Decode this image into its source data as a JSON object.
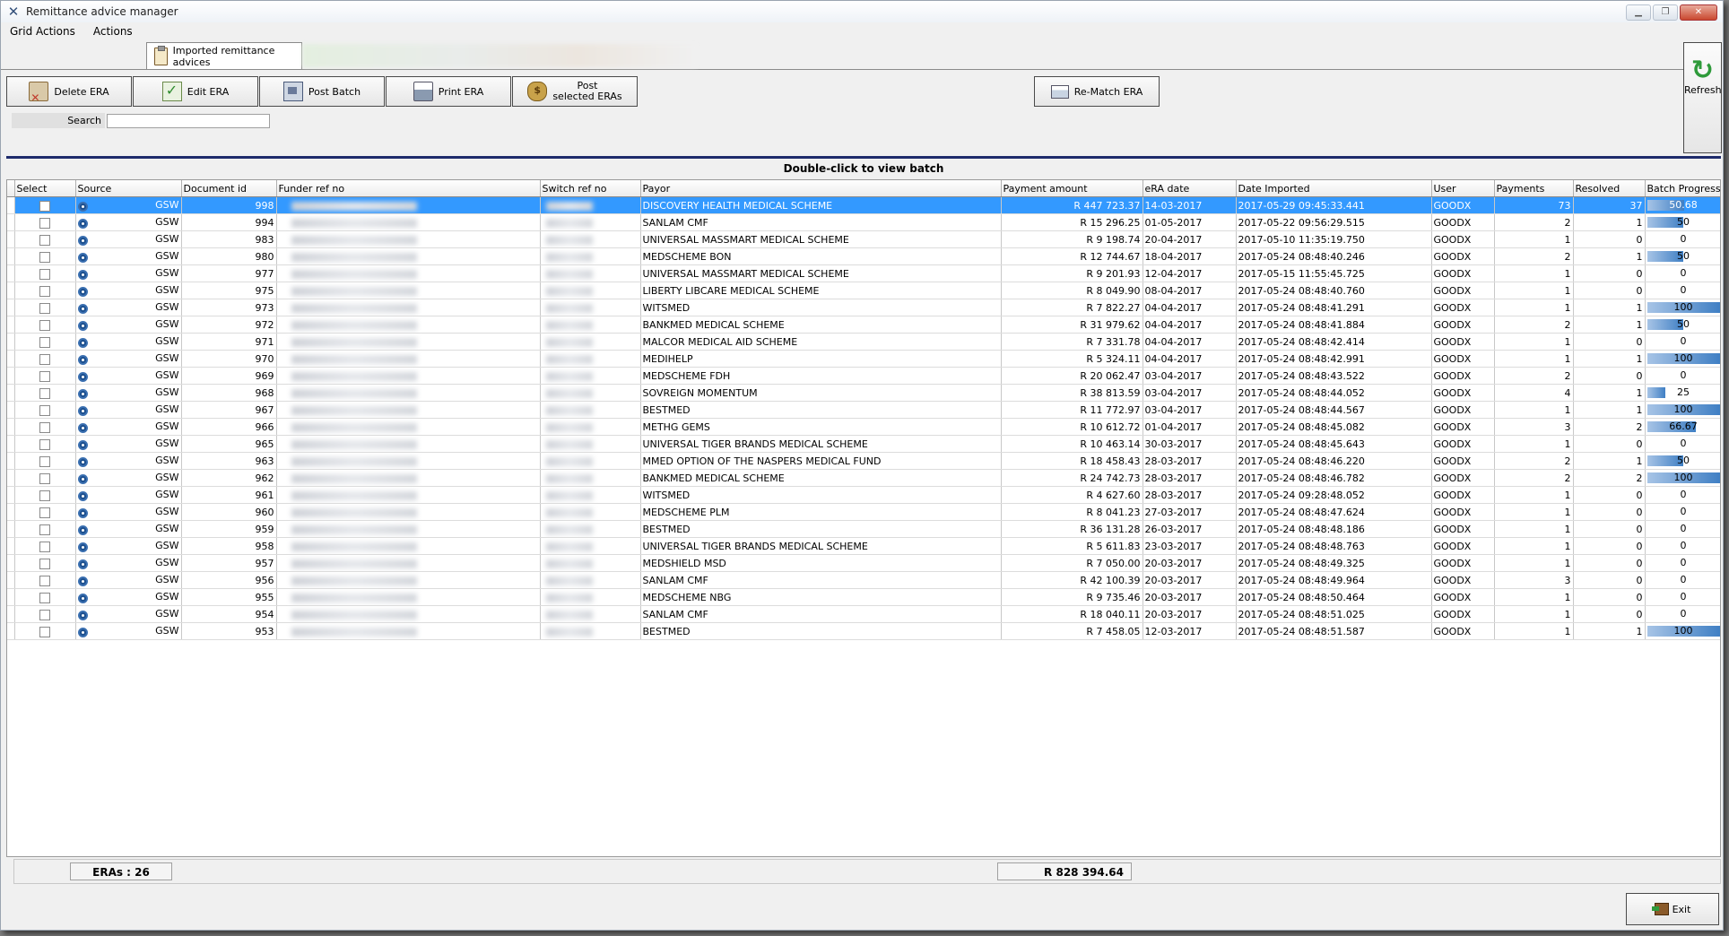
{
  "window": {
    "title": "Remittance advice manager"
  },
  "menu": [
    "Grid Actions",
    "Actions"
  ],
  "tabs": {
    "active_label": "Imported remittance advices"
  },
  "toolbar": {
    "delete": "Delete ERA",
    "edit": "Edit ERA",
    "post_batch": "Post Batch",
    "print": "Print ERA",
    "post_selected_line1": "Post",
    "post_selected_line2": "selected ERAs",
    "rematch": "Re-Match ERA",
    "refresh": "Refresh"
  },
  "search": {
    "label": "Search",
    "value": ""
  },
  "grid": {
    "caption": "Double-click to view batch",
    "columns": [
      "Select",
      "Source",
      "Document id",
      "Funder ref no",
      "Switch ref no",
      "Payor",
      "Payment amount",
      "eRA date",
      "Date Imported",
      "User",
      "Payments",
      "Resolved",
      "Batch Progress (%)"
    ],
    "rows": [
      {
        "source": "GSW",
        "doc": "998",
        "payor": "DISCOVERY HEALTH MEDICAL SCHEME",
        "amount": "R 447 723.37",
        "era_date": "14-03-2017",
        "imported": "2017-05-29 09:45:33.441",
        "user": "GOODX",
        "payments": "73",
        "resolved": "37",
        "progress": "50.68"
      },
      {
        "source": "GSW",
        "doc": "994",
        "payor": "SANLAM CMF",
        "amount": "R 15 296.25",
        "era_date": "01-05-2017",
        "imported": "2017-05-22 09:56:29.515",
        "user": "GOODX",
        "payments": "2",
        "resolved": "1",
        "progress": "50"
      },
      {
        "source": "GSW",
        "doc": "983",
        "payor": "UNIVERSAL MASSMART MEDICAL SCHEME",
        "amount": "R 9 198.74",
        "era_date": "20-04-2017",
        "imported": "2017-05-10 11:35:19.750",
        "user": "GOODX",
        "payments": "1",
        "resolved": "0",
        "progress": "0"
      },
      {
        "source": "GSW",
        "doc": "980",
        "payor": "MEDSCHEME BON",
        "amount": "R 12 744.67",
        "era_date": "18-04-2017",
        "imported": "2017-05-24 08:48:40.246",
        "user": "GOODX",
        "payments": "2",
        "resolved": "1",
        "progress": "50"
      },
      {
        "source": "GSW",
        "doc": "977",
        "payor": "UNIVERSAL MASSMART MEDICAL SCHEME",
        "amount": "R 9 201.93",
        "era_date": "12-04-2017",
        "imported": "2017-05-15 11:55:45.725",
        "user": "GOODX",
        "payments": "1",
        "resolved": "0",
        "progress": "0"
      },
      {
        "source": "GSW",
        "doc": "975",
        "payor": "LIBERTY LIBCARE MEDICAL SCHEME",
        "amount": "R 8 049.90",
        "era_date": "08-04-2017",
        "imported": "2017-05-24 08:48:40.760",
        "user": "GOODX",
        "payments": "1",
        "resolved": "0",
        "progress": "0"
      },
      {
        "source": "GSW",
        "doc": "973",
        "payor": "WITSMED",
        "amount": "R 7 822.27",
        "era_date": "04-04-2017",
        "imported": "2017-05-24 08:48:41.291",
        "user": "GOODX",
        "payments": "1",
        "resolved": "1",
        "progress": "100"
      },
      {
        "source": "GSW",
        "doc": "972",
        "payor": "BANKMED MEDICAL SCHEME",
        "amount": "R 31 979.62",
        "era_date": "04-04-2017",
        "imported": "2017-05-24 08:48:41.884",
        "user": "GOODX",
        "payments": "2",
        "resolved": "1",
        "progress": "50"
      },
      {
        "source": "GSW",
        "doc": "971",
        "payor": "MALCOR MEDICAL AID SCHEME",
        "amount": "R 7 331.78",
        "era_date": "04-04-2017",
        "imported": "2017-05-24 08:48:42.414",
        "user": "GOODX",
        "payments": "1",
        "resolved": "0",
        "progress": "0"
      },
      {
        "source": "GSW",
        "doc": "970",
        "payor": "MEDIHELP",
        "amount": "R 5 324.11",
        "era_date": "04-04-2017",
        "imported": "2017-05-24 08:48:42.991",
        "user": "GOODX",
        "payments": "1",
        "resolved": "1",
        "progress": "100"
      },
      {
        "source": "GSW",
        "doc": "969",
        "payor": "MEDSCHEME FDH",
        "amount": "R 20 062.47",
        "era_date": "03-04-2017",
        "imported": "2017-05-24 08:48:43.522",
        "user": "GOODX",
        "payments": "2",
        "resolved": "0",
        "progress": "0"
      },
      {
        "source": "GSW",
        "doc": "968",
        "payor": "SOVREIGN MOMENTUM",
        "amount": "R 38 813.59",
        "era_date": "03-04-2017",
        "imported": "2017-05-24 08:48:44.052",
        "user": "GOODX",
        "payments": "4",
        "resolved": "1",
        "progress": "25"
      },
      {
        "source": "GSW",
        "doc": "967",
        "payor": "BESTMED",
        "amount": "R 11 772.97",
        "era_date": "03-04-2017",
        "imported": "2017-05-24 08:48:44.567",
        "user": "GOODX",
        "payments": "1",
        "resolved": "1",
        "progress": "100"
      },
      {
        "source": "GSW",
        "doc": "966",
        "payor": "METHG GEMS",
        "amount": "R 10 612.72",
        "era_date": "01-04-2017",
        "imported": "2017-05-24 08:48:45.082",
        "user": "GOODX",
        "payments": "3",
        "resolved": "2",
        "progress": "66.67"
      },
      {
        "source": "GSW",
        "doc": "965",
        "payor": "UNIVERSAL TIGER BRANDS MEDICAL SCHEME",
        "amount": "R 10 463.14",
        "era_date": "30-03-2017",
        "imported": "2017-05-24 08:48:45.643",
        "user": "GOODX",
        "payments": "1",
        "resolved": "0",
        "progress": "0"
      },
      {
        "source": "GSW",
        "doc": "963",
        "payor": "MMED OPTION OF THE NASPERS MEDICAL FUND",
        "amount": "R 18 458.43",
        "era_date": "28-03-2017",
        "imported": "2017-05-24 08:48:46.220",
        "user": "GOODX",
        "payments": "2",
        "resolved": "1",
        "progress": "50"
      },
      {
        "source": "GSW",
        "doc": "962",
        "payor": "BANKMED MEDICAL SCHEME",
        "amount": "R 24 742.73",
        "era_date": "28-03-2017",
        "imported": "2017-05-24 08:48:46.782",
        "user": "GOODX",
        "payments": "2",
        "resolved": "2",
        "progress": "100"
      },
      {
        "source": "GSW",
        "doc": "961",
        "payor": "WITSMED",
        "amount": "R 4 627.60",
        "era_date": "28-03-2017",
        "imported": "2017-05-24 09:28:48.052",
        "user": "GOODX",
        "payments": "1",
        "resolved": "0",
        "progress": "0"
      },
      {
        "source": "GSW",
        "doc": "960",
        "payor": "MEDSCHEME PLM",
        "amount": "R 8 041.23",
        "era_date": "27-03-2017",
        "imported": "2017-05-24 08:48:47.624",
        "user": "GOODX",
        "payments": "1",
        "resolved": "0",
        "progress": "0"
      },
      {
        "source": "GSW",
        "doc": "959",
        "payor": "BESTMED",
        "amount": "R 36 131.28",
        "era_date": "26-03-2017",
        "imported": "2017-05-24 08:48:48.186",
        "user": "GOODX",
        "payments": "1",
        "resolved": "0",
        "progress": "0"
      },
      {
        "source": "GSW",
        "doc": "958",
        "payor": "UNIVERSAL TIGER BRANDS MEDICAL SCHEME",
        "amount": "R 5 611.83",
        "era_date": "23-03-2017",
        "imported": "2017-05-24 08:48:48.763",
        "user": "GOODX",
        "payments": "1",
        "resolved": "0",
        "progress": "0"
      },
      {
        "source": "GSW",
        "doc": "957",
        "payor": "MEDSHIELD MSD",
        "amount": "R 7 050.00",
        "era_date": "20-03-2017",
        "imported": "2017-05-24 08:48:49.325",
        "user": "GOODX",
        "payments": "1",
        "resolved": "0",
        "progress": "0"
      },
      {
        "source": "GSW",
        "doc": "956",
        "payor": "SANLAM CMF",
        "amount": "R 42 100.39",
        "era_date": "20-03-2017",
        "imported": "2017-05-24 08:48:49.964",
        "user": "GOODX",
        "payments": "3",
        "resolved": "0",
        "progress": "0"
      },
      {
        "source": "GSW",
        "doc": "955",
        "payor": "MEDSCHEME NBG",
        "amount": "R 9 735.46",
        "era_date": "20-03-2017",
        "imported": "2017-05-24 08:48:50.464",
        "user": "GOODX",
        "payments": "1",
        "resolved": "0",
        "progress": "0"
      },
      {
        "source": "GSW",
        "doc": "954",
        "payor": "SANLAM CMF",
        "amount": "R 18 040.11",
        "era_date": "20-03-2017",
        "imported": "2017-05-24 08:48:51.025",
        "user": "GOODX",
        "payments": "1",
        "resolved": "0",
        "progress": "0"
      },
      {
        "source": "GSW",
        "doc": "953",
        "payor": "BESTMED",
        "amount": "R 7 458.05",
        "era_date": "12-03-2017",
        "imported": "2017-05-24 08:48:51.587",
        "user": "GOODX",
        "payments": "1",
        "resolved": "1",
        "progress": "100"
      }
    ]
  },
  "footer": {
    "count": "ERAs : 26",
    "total": "R 828 394.64"
  },
  "exit_label": "Exit",
  "colors": {
    "selection": "#3399ff",
    "separator": "#1e2b6b",
    "progress": "#3f7fc4"
  }
}
